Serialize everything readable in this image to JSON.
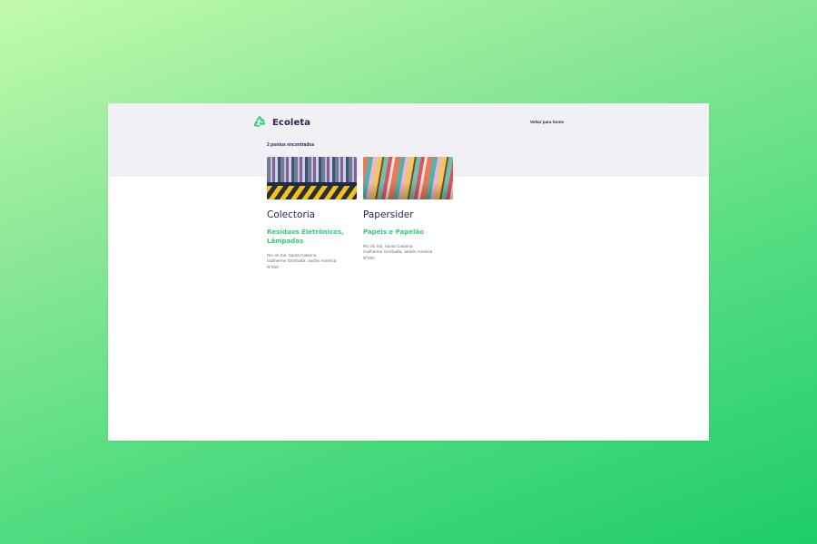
{
  "header": {
    "logo_text": "Ecoleta",
    "home_link": "Voltar para home"
  },
  "results": {
    "count_label": "2 pontos encontrados"
  },
  "points": [
    {
      "name": "Colectoria",
      "items": "Resíduos Eletrônicos, Lâmpadas",
      "address_city": "Rio do Sul, Santa Catarina",
      "address_street": "Guilherme Gemballa, Jardim América",
      "address_number": "Nº260",
      "image": "electronic-waste-photo"
    },
    {
      "name": "Papersider",
      "items": "Papéis e Papelão",
      "address_city": "Rio do Sul, Santa Catarina",
      "address_street": "Guilherme Gemballa, Jardim América",
      "address_number": "Nº260",
      "image": "paper-recycling-photo"
    }
  ],
  "colors": {
    "brand_purple": "#322153",
    "brand_green": "#34cb79",
    "top_band": "#f0f0f5",
    "text_muted": "#6c6c80"
  },
  "icons": {
    "logo": "recycle-icon"
  }
}
